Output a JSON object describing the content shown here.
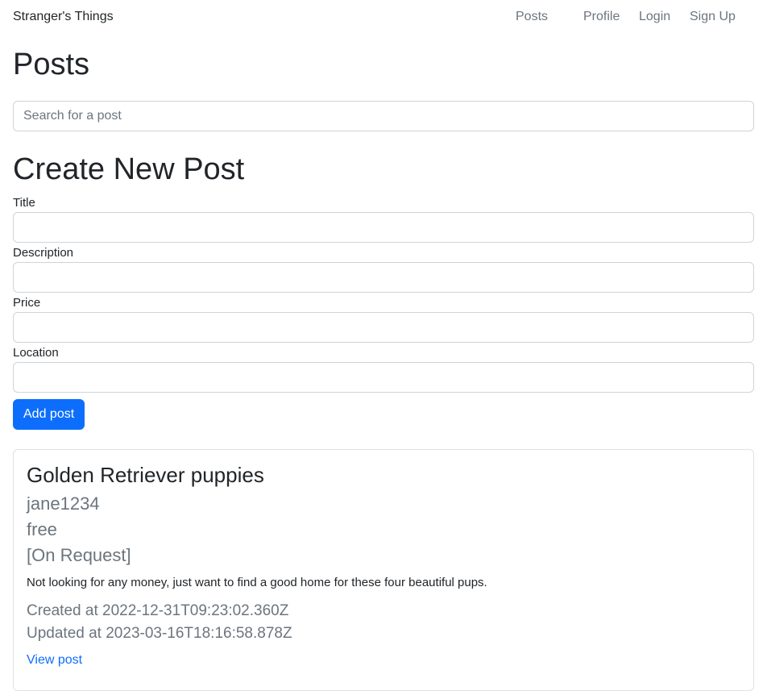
{
  "navbar": {
    "brand": "Stranger's Things",
    "links": [
      "Posts",
      "Profile",
      "Login",
      "Sign Up"
    ]
  },
  "page": {
    "title": "Posts",
    "search_placeholder": "Search for a post"
  },
  "create_post": {
    "title": "Create New Post",
    "fields": {
      "title_label": "Title",
      "description_label": "Description",
      "price_label": "Price",
      "location_label": "Location"
    },
    "submit_label": "Add post"
  },
  "posts": [
    {
      "title": "Golden Retriever puppies",
      "author": "jane1234",
      "price": "free",
      "location": "[On Request]",
      "description": "Not looking for any money, just want to find a good home for these four beautiful pups.",
      "created": "Created at 2022-12-31T09:23:02.360Z",
      "updated": "Updated at 2023-03-16T18:16:58.878Z",
      "link_label": "View post"
    }
  ],
  "colors": {
    "primary": "#0d6efd",
    "muted": "#6c757d",
    "text": "#212529",
    "border": "#ced4da"
  }
}
